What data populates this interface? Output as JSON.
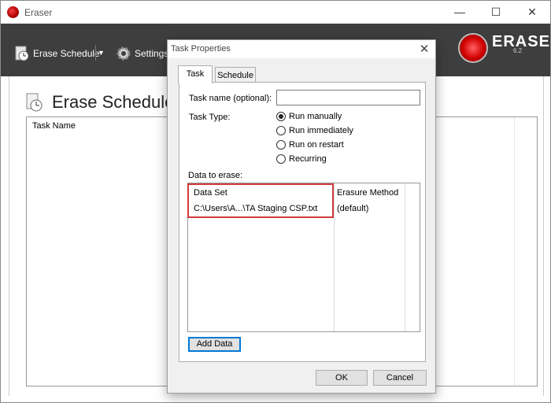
{
  "window": {
    "title": "Eraser",
    "controls": {
      "minimize": "—",
      "maximize": "☐",
      "close": "✕"
    }
  },
  "toolbar": {
    "erase_schedule_label": "Erase Schedule",
    "settings_label": "Settings",
    "dropdown_glyph": "▼"
  },
  "logo": {
    "name": "ERASER",
    "version": "6.2"
  },
  "main": {
    "page_title": "Erase Schedule",
    "task_list_header": "Task Name"
  },
  "dialog": {
    "title": "Task Properties",
    "close_glyph": "✕",
    "tabs": [
      {
        "label": "Task",
        "active": true
      },
      {
        "label": "Schedule",
        "active": false
      }
    ],
    "task_name_label": "Task name (optional):",
    "task_name_value": "",
    "task_type_label": "Task Type:",
    "task_types": [
      {
        "label": "Run manually",
        "checked": true
      },
      {
        "label": "Run immediately",
        "checked": false
      },
      {
        "label": "Run on restart",
        "checked": false
      },
      {
        "label": "Recurring",
        "checked": false
      }
    ],
    "data_to_erase_label": "Data to erase:",
    "data_columns": {
      "data_set": "Data Set",
      "erasure_method": "Erasure Method"
    },
    "data_rows": [
      {
        "data_set": "C:\\Users\\A...\\TA Staging CSP.txt",
        "erasure_method": "(default)"
      }
    ],
    "add_data_label": "Add Data",
    "ok_label": "OK",
    "cancel_label": "Cancel"
  },
  "colors": {
    "toolbar_bg": "#3e3e3e",
    "highlight": "#d33c3c",
    "focus": "#0078d7"
  }
}
